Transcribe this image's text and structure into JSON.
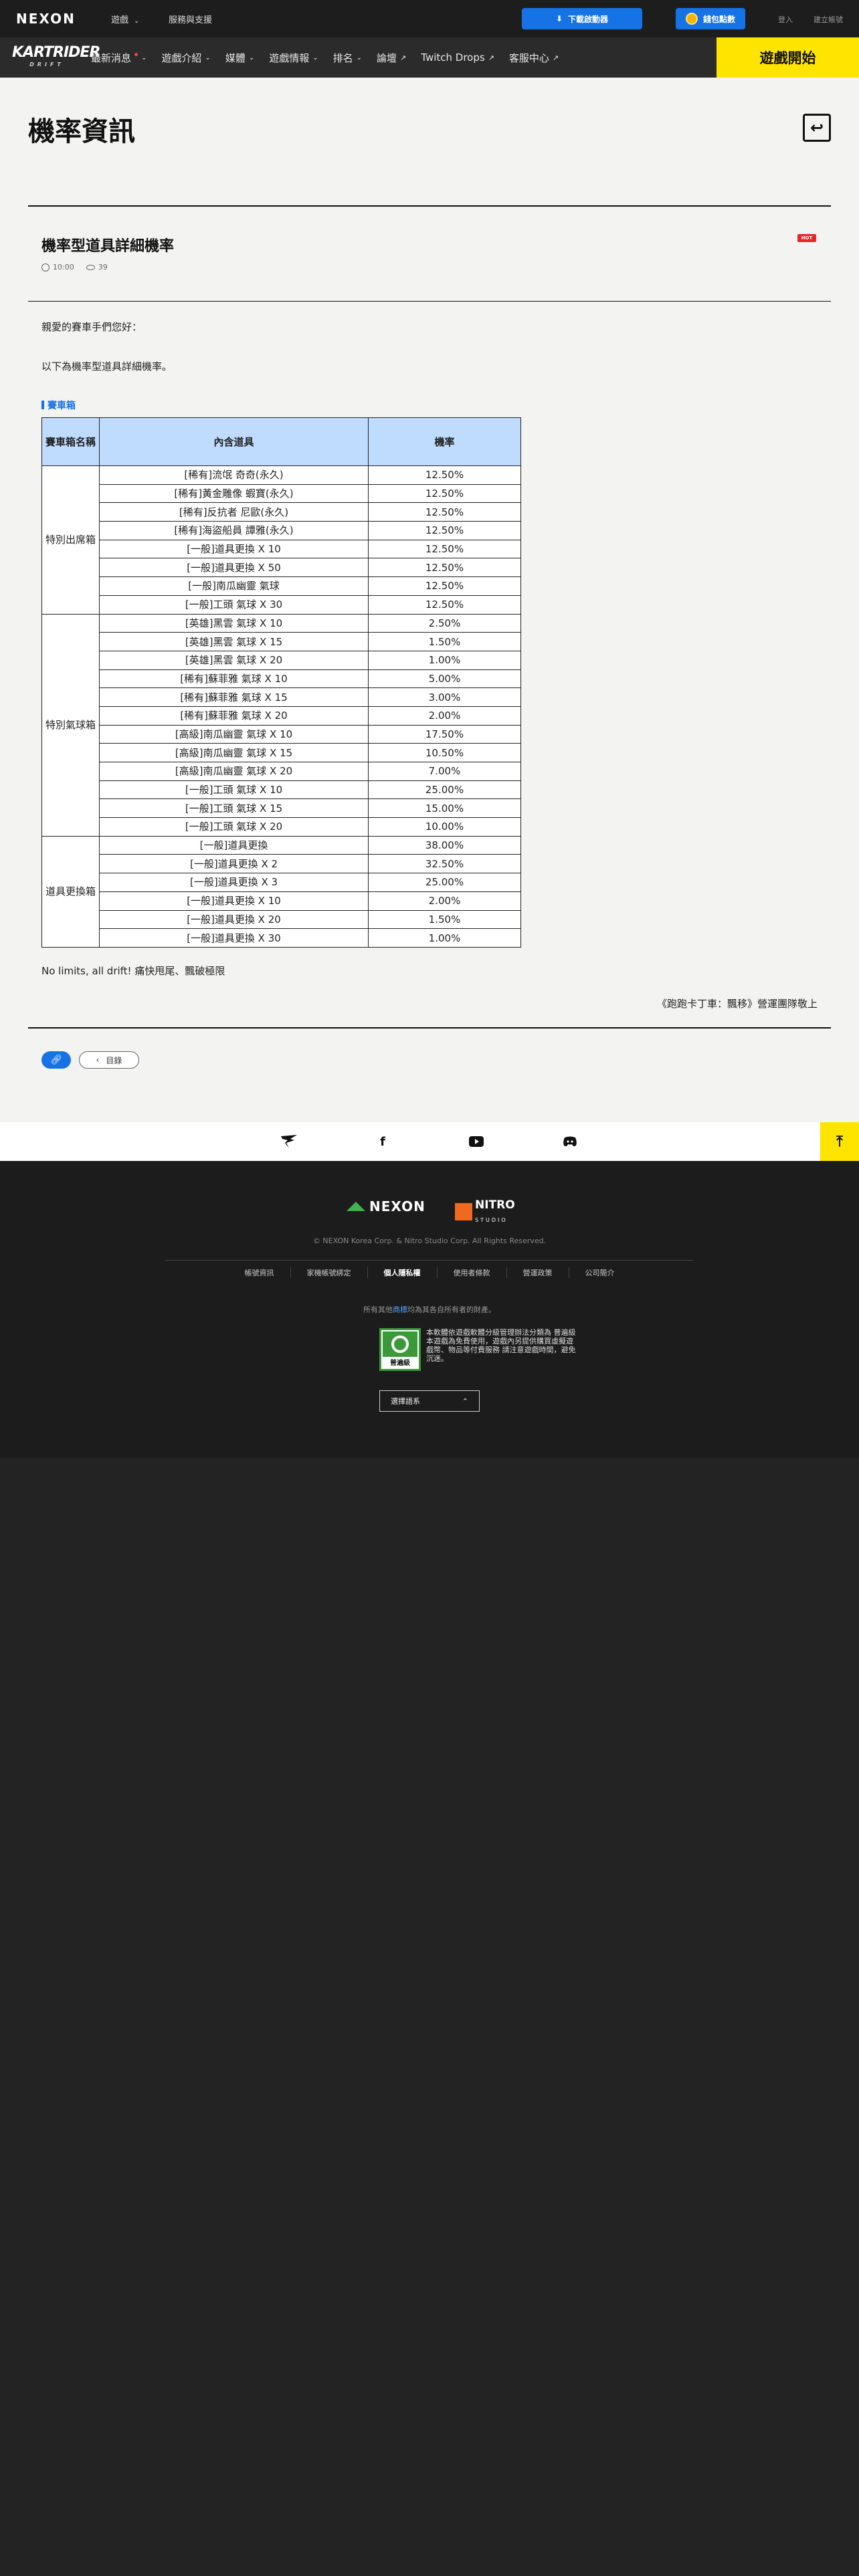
{
  "topbar": {
    "brand": "NEXON",
    "game_menu": "遊戲",
    "support": "服務與支援",
    "download": "下載啟動器",
    "points": "錢包點數",
    "login": "登入",
    "signup": "建立帳號"
  },
  "gamenav": {
    "logo": "KARTRIDER",
    "logo_sub": "DRIFT",
    "items": [
      {
        "label": "最新消息"
      },
      {
        "label": "遊戲介紹"
      },
      {
        "label": "媒體"
      },
      {
        "label": "遊戲情報"
      },
      {
        "label": "排名"
      },
      {
        "label": "論壇"
      },
      {
        "label": "Twitch Drops"
      },
      {
        "label": "客服中心"
      }
    ],
    "start": "遊戲開始"
  },
  "page": {
    "title": "機率資訊"
  },
  "article": {
    "title": "機率型道具詳細機率",
    "badge": "HOT",
    "time": "10:00",
    "views": "39",
    "greeting": "親愛的賽車手們您好：",
    "intro": "以下為機率型道具詳細機率。",
    "section": "賽車箱",
    "table": {
      "headers": [
        "賽車箱名稱",
        "內含道具",
        "機率"
      ],
      "groups": [
        {
          "name": "特別出席箱",
          "rows": [
            [
              "[稀有]流氓 奇奇(永久)",
              "12.50%"
            ],
            [
              "[稀有]黃金雕像 蝦寶(永久)",
              "12.50%"
            ],
            [
              "[稀有]反抗者 尼歐(永久)",
              "12.50%"
            ],
            [
              "[稀有]海盜船員 譚雅(永久)",
              "12.50%"
            ],
            [
              "[一般]道具更換 X 10",
              "12.50%"
            ],
            [
              "[一般]道具更換 X 50",
              "12.50%"
            ],
            [
              "[一般]南瓜幽靈 氣球",
              "12.50%"
            ],
            [
              "[一般]工頭 氣球 X 30",
              "12.50%"
            ]
          ]
        },
        {
          "name": "特別氣球箱",
          "rows": [
            [
              "[英雄]黑雲 氣球 X 10",
              "2.50%"
            ],
            [
              "[英雄]黑雲 氣球 X 15",
              "1.50%"
            ],
            [
              "[英雄]黑雲 氣球 X 20",
              "1.00%"
            ],
            [
              "[稀有]蘇菲雅 氣球 X 10",
              "5.00%"
            ],
            [
              "[稀有]蘇菲雅 氣球 X 15",
              "3.00%"
            ],
            [
              "[稀有]蘇菲雅 氣球 X 20",
              "2.00%"
            ],
            [
              "[高級]南瓜幽靈 氣球 X 10",
              "17.50%"
            ],
            [
              "[高級]南瓜幽靈 氣球 X 15",
              "10.50%"
            ],
            [
              "[高級]南瓜幽靈 氣球 X 20",
              "7.00%"
            ],
            [
              "[一般]工頭 氣球 X 10",
              "25.00%"
            ],
            [
              "[一般]工頭 氣球 X 15",
              "15.00%"
            ],
            [
              "[一般]工頭 氣球 X 20",
              "10.00%"
            ]
          ]
        },
        {
          "name": "道具更換箱",
          "rows": [
            [
              "[一般]道具更換",
              "38.00%"
            ],
            [
              "[一般]道具更換 X 2",
              "32.50%"
            ],
            [
              "[一般]道具更換 X 3",
              "25.00%"
            ],
            [
              "[一般]道具更換 X 10",
              "2.00%"
            ],
            [
              "[一般]道具更換 X 20",
              "1.50%"
            ],
            [
              "[一般]道具更換 X 30",
              "1.00%"
            ]
          ]
        }
      ]
    },
    "closing": "No limits, all drift! 痛快甩尾、飄破極限",
    "signature": "《跑跑卡丁車：飄移》營運團隊敬上",
    "list_button": "目錄"
  },
  "social": {
    "icons": [
      "kartrider-logo-icon",
      "facebook-icon",
      "youtube-icon",
      "discord-icon"
    ]
  },
  "footer": {
    "nexon": "NEXON",
    "nitro": "NITRO",
    "nitro_sub": "STUDIO",
    "copyright": "© NEXON Korea Corp. & Nitro Studio Corp. All Rights Reserved.",
    "links": [
      "帳號資訊",
      "家機帳號綁定",
      "個人隱私權",
      "使用者條款",
      "營運政策",
      "公司簡介"
    ],
    "owner_pre": "所有其他",
    "owner_hl": "商標",
    "owner_post": "均為其各自所有者的財產。",
    "rating_label": "普遍級",
    "rating_text": "本軟體依遊戲軟體分級管理辦法分類為 普遍級 本遊戲為免費使用，遊戲內另提供購買虛擬遊戲幣、物品等付費服務 請注意遊戲時間，避免沉迷。",
    "language": "選擇語系"
  }
}
